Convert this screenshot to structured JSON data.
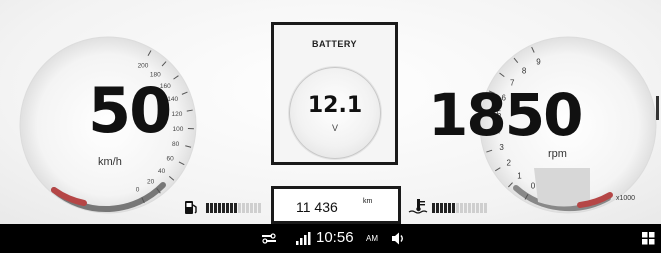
{
  "speedometer": {
    "value": "50",
    "unit": "km/h",
    "scale": [
      "0",
      "20",
      "40",
      "60",
      "80",
      "100",
      "120",
      "140",
      "160",
      "180",
      "200"
    ]
  },
  "battery": {
    "title": "BATTERY",
    "value": "12.1",
    "unit": "V"
  },
  "tachometer": {
    "value": "1850",
    "unit": "rpm",
    "scale": [
      "0",
      "1",
      "2",
      "3",
      "4",
      "5",
      "6",
      "7",
      "8",
      "9"
    ],
    "multiplier": "x1000"
  },
  "fuel": {
    "icon": "fuel-pump-icon",
    "level_fraction": 0.55
  },
  "odometer": {
    "value": "11 436",
    "unit": "km"
  },
  "coolant": {
    "icon": "coolant-temperature-icon",
    "level_fraction": 0.4
  },
  "taskbar": {
    "time": "10:56",
    "ampm": "AM",
    "icons": [
      "connection-icon",
      "signal-strength-icon",
      "volume-icon",
      "apps-grid-icon"
    ]
  },
  "colors": {
    "accent_red": "#c24a4a",
    "taskbar_bg": "#000000"
  }
}
